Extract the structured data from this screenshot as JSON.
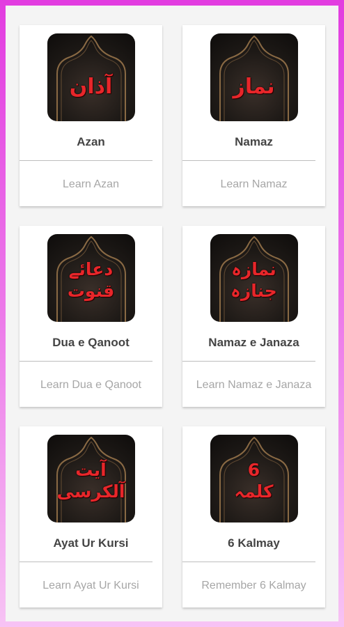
{
  "cards": [
    {
      "urdu": [
        "آذان"
      ],
      "title": "Azan",
      "subtitle": "Learn Azan"
    },
    {
      "urdu": [
        "نماز"
      ],
      "title": "Namaz",
      "subtitle": "Learn Namaz"
    },
    {
      "urdu": [
        "دعائے",
        "قنوت"
      ],
      "title": "Dua e Qanoot",
      "subtitle": "Learn Dua e Qanoot"
    },
    {
      "urdu": [
        "نمازہ",
        "جنازہ"
      ],
      "title": "Namaz e Janaza",
      "subtitle": "Learn Namaz e Janaza"
    },
    {
      "urdu": [
        "آیت",
        "آلکرسی"
      ],
      "title": "Ayat Ur Kursi",
      "subtitle": "Learn Ayat Ur Kursi"
    },
    {
      "urdu": [
        "6",
        "کلمہ"
      ],
      "title": "6 Kalmay",
      "subtitle": "Remember 6 Kalmay"
    }
  ],
  "colors": {
    "background_top": "#e23ce0",
    "background_bottom": "#f7c3f4",
    "urdu_text": "#e8262a",
    "title_text": "#444444",
    "subtitle_text": "#a6a6a6"
  }
}
